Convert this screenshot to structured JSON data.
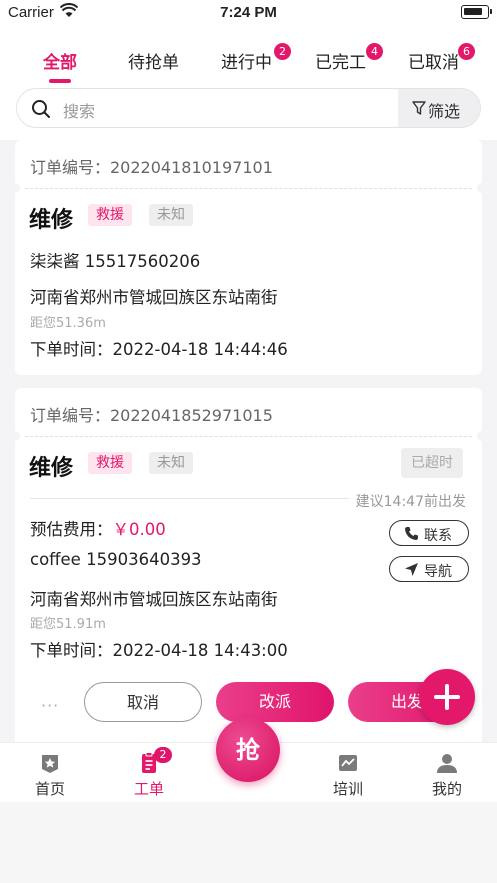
{
  "status_bar": {
    "carrier": "Carrier",
    "time": "7:24 PM"
  },
  "tabs": [
    {
      "label": "全部",
      "badge": null,
      "active": true
    },
    {
      "label": "待抢单",
      "badge": null,
      "active": false
    },
    {
      "label": "进行中",
      "badge": "2",
      "active": false
    },
    {
      "label": "已完工",
      "badge": "4",
      "active": false
    },
    {
      "label": "已取消",
      "badge": "6",
      "active": false
    }
  ],
  "search": {
    "placeholder": "搜索",
    "filter_label": "筛选"
  },
  "orders": [
    {
      "order_no": "订单编号：2022041810197101",
      "kind": "维修",
      "tags": [
        "救援",
        "未知"
      ],
      "contact": "柒柒酱 15517560206",
      "address": "河南省郑州市管城回族区东站南街",
      "distance": "距您51.36m",
      "order_time": "下单时间：2022-04-18 14:44:46"
    },
    {
      "order_no": "订单编号：2022041852971015",
      "kind": "维修",
      "tags": [
        "救援",
        "未知"
      ],
      "timeout_label": "已超时",
      "suggest": "建议14:47前出发",
      "fee_label": "预估费用：",
      "fee_value": "￥0.00",
      "contact": "coffee 15903640393",
      "address": "河南省郑州市管城回族区东站南街",
      "distance": "距您51.91m",
      "order_time": "下单时间：2022-04-18 14:43:00",
      "contact_btn": "联系",
      "nav_btn": "导航"
    }
  ],
  "actions": {
    "more": "···",
    "cancel": "取消",
    "reassign": "改派",
    "depart": "出发"
  },
  "grab_button": "抢",
  "tabbar": [
    {
      "label": "首页",
      "icon": "home-star-icon"
    },
    {
      "label": "工单",
      "icon": "work-order-icon",
      "badge": "2",
      "active": true
    },
    {
      "label": "培训",
      "icon": "training-chart-icon"
    },
    {
      "label": "我的",
      "icon": "profile-icon"
    }
  ],
  "colors": {
    "accent": "#e3186b",
    "tag_bg": "#fde4ef"
  }
}
